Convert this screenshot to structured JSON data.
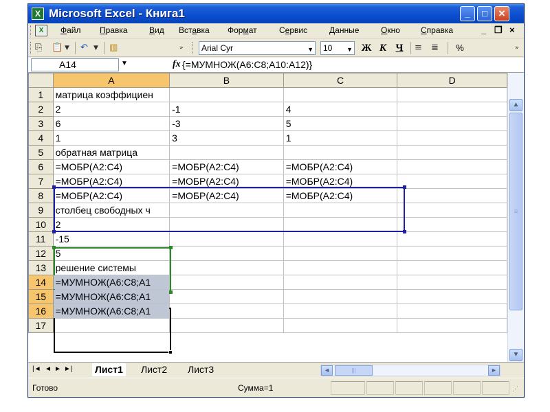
{
  "window": {
    "title": "Microsoft Excel - Книга1",
    "controls": {
      "minimize": "_",
      "maximize": "□",
      "close": "✕"
    }
  },
  "menubar": {
    "items": [
      {
        "label": "Файл",
        "mnemonic": "Ф",
        "rest": "айл"
      },
      {
        "label": "Правка",
        "mnemonic": "П",
        "rest": "равка"
      },
      {
        "label": "Вид",
        "mnemonic": "В",
        "rest": "ид"
      },
      {
        "label": "Вставка",
        "pre": "Вст",
        "mnemonic": "а",
        "rest": "вка"
      },
      {
        "label": "Формат",
        "pre": "Фор",
        "mnemonic": "м",
        "rest": "ат"
      },
      {
        "label": "Сервис",
        "pre": "С",
        "mnemonic": "е",
        "rest": "рвис"
      },
      {
        "label": "Данные",
        "mnemonic": "Д",
        "rest": "анные"
      },
      {
        "label": "Окно",
        "mnemonic": "О",
        "rest": "кно"
      },
      {
        "label": "Справка",
        "mnemonic": "С",
        "rest": "правка"
      }
    ],
    "doc_controls": {
      "minimize": "_",
      "restore": "❐",
      "close": "×"
    }
  },
  "toolbar": {
    "font": "Arial Cyr",
    "size": "10",
    "bold": "Ж",
    "italic": "К",
    "underline": "Ч",
    "percent": "%"
  },
  "formula_bar": {
    "name_box": "A14",
    "fx": "fx",
    "formula": "{=МУМНОЖ(A6:C8;A10:A12)}"
  },
  "grid": {
    "columns": [
      "A",
      "B",
      "C",
      "D"
    ],
    "selected_column": "A",
    "rows": [
      {
        "n": "1",
        "cells": [
          "матрица коэффициен",
          "",
          "",
          ""
        ]
      },
      {
        "n": "2",
        "cells": [
          "2",
          "-1",
          "4",
          ""
        ]
      },
      {
        "n": "3",
        "cells": [
          "6",
          "-3",
          "5",
          ""
        ]
      },
      {
        "n": "4",
        "cells": [
          "1",
          "3",
          "1",
          ""
        ]
      },
      {
        "n": "5",
        "cells": [
          "обратная матрица",
          "",
          "",
          ""
        ]
      },
      {
        "n": "6",
        "cells": [
          "=МОБР(A2:C4)",
          "=МОБР(A2:C4)",
          "=МОБР(A2:C4)",
          ""
        ]
      },
      {
        "n": "7",
        "cells": [
          "=МОБР(A2:C4)",
          "=МОБР(A2:C4)",
          "=МОБР(A2:C4)",
          ""
        ]
      },
      {
        "n": "8",
        "cells": [
          "=МОБР(A2:C4)",
          "=МОБР(A2:C4)",
          "=МОБР(A2:C4)",
          ""
        ]
      },
      {
        "n": "9",
        "cells": [
          "столбец свободных ч",
          "",
          "",
          ""
        ]
      },
      {
        "n": "10",
        "cells": [
          "2",
          "",
          "",
          ""
        ]
      },
      {
        "n": "11",
        "cells": [
          "-15",
          "",
          "",
          ""
        ]
      },
      {
        "n": "12",
        "cells": [
          "5",
          "",
          "",
          ""
        ]
      },
      {
        "n": "13",
        "cells": [
          "решение системы",
          "",
          "",
          ""
        ]
      },
      {
        "n": "14",
        "cells": [
          "=МУМНОЖ(A6:C8;A1",
          "",
          "",
          ""
        ]
      },
      {
        "n": "15",
        "cells": [
          "=МУМНОЖ(A6:C8;A1",
          "",
          "",
          ""
        ]
      },
      {
        "n": "16",
        "cells": [
          "=МУМНОЖ(A6:C8;A1",
          "",
          "",
          ""
        ]
      },
      {
        "n": "17",
        "cells": [
          "",
          "",
          "",
          ""
        ]
      }
    ],
    "selected_rows": [
      "14",
      "15",
      "16"
    ]
  },
  "sheet_tabs": {
    "tabs": [
      "Лист1",
      "Лист2",
      "Лист3"
    ],
    "active": "Лист1",
    "nav": [
      "|◄",
      "◄",
      "►",
      "►|"
    ]
  },
  "statusbar": {
    "ready": "Готово",
    "sum": "Сумма=1"
  },
  "colors": {
    "title_bar": "#0a4ed0",
    "selection_border": "#000000",
    "range_blue": "#1f1fa8",
    "range_green": "#2a8a2a",
    "header_selected": "#f7c56b",
    "selected_cells": "#bfc6d6"
  }
}
